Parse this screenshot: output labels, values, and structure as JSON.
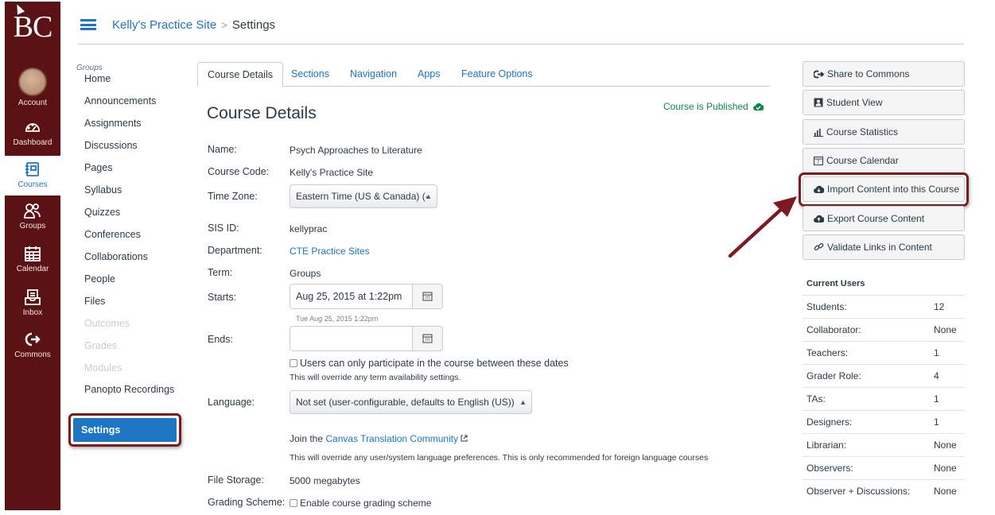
{
  "global_nav": {
    "logo": "BC",
    "items": [
      {
        "label": "Account",
        "icon": "avatar"
      },
      {
        "label": "Dashboard",
        "icon": "dashboard-icon"
      },
      {
        "label": "Courses",
        "icon": "courses-icon",
        "active": true
      },
      {
        "label": "Groups",
        "icon": "groups-icon"
      },
      {
        "label": "Calendar",
        "icon": "calendar-icon"
      },
      {
        "label": "Inbox",
        "icon": "inbox-icon"
      },
      {
        "label": "Commons",
        "icon": "commons-icon"
      }
    ]
  },
  "header": {
    "site": "Kelly's Practice Site",
    "separator": ">",
    "current": "Settings"
  },
  "course_nav": {
    "group_label": "Groups",
    "items": [
      "Home",
      "Announcements",
      "Assignments",
      "Discussions",
      "Pages",
      "Syllabus",
      "Quizzes",
      "Conferences",
      "Collaborations",
      "People",
      "Files"
    ],
    "disabled": [
      "Outcomes",
      "Grades",
      "Modules"
    ],
    "panopto": "Panopto Recordings",
    "settings": "Settings"
  },
  "tabs": [
    "Course Details",
    "Sections",
    "Navigation",
    "Apps",
    "Feature Options"
  ],
  "details": {
    "title": "Course Details",
    "published": "Course is Published",
    "name_label": "Name:",
    "name": "Psych Approaches to Literature",
    "code_label": "Course Code:",
    "code": "Kelly's Practice Site",
    "tz_label": "Time Zone:",
    "tz": "Eastern Time (US & Canada) (-",
    "sis_label": "SIS ID:",
    "sis": "kellyprac",
    "dept_label": "Department:",
    "dept": "CTE Practice Sites",
    "term_label": "Term:",
    "term": "Groups",
    "starts_label": "Starts:",
    "starts": "Aug 25, 2015 at  1:22pm",
    "starts_hint": "Tue Aug 25, 2015 1:22pm",
    "ends_label": "Ends:",
    "ends": "",
    "restrict_label": "Users can only participate in the course between these dates",
    "restrict_note": "This will override any term availability settings.",
    "lang_label": "Language:",
    "lang": "Not set (user-configurable, defaults to English (US))",
    "join_text": "Join the ",
    "join_link": "Canvas Translation Community",
    "lang_note": "This will override any user/system language preferences. This is only recommended for foreign language courses",
    "storage_label": "File Storage:",
    "storage": "5000 megabytes",
    "grading_label": "Grading Scheme:",
    "grading": "Enable course grading scheme"
  },
  "sidebar": {
    "buttons": [
      {
        "label": "Share to Commons",
        "icon": "share-icon"
      },
      {
        "label": "Student View",
        "icon": "student-view-icon"
      },
      {
        "label": "Course Statistics",
        "icon": "statistics-icon"
      },
      {
        "label": "Course Calendar",
        "icon": "calendar-icon"
      },
      {
        "label": "Import Content into this Course",
        "icon": "cloud-download-icon"
      },
      {
        "label": "Export Course Content",
        "icon": "cloud-upload-icon"
      },
      {
        "label": "Validate Links in Content",
        "icon": "link-icon"
      }
    ],
    "users_title": "Current Users",
    "users": [
      {
        "role": "Students:",
        "count": "12"
      },
      {
        "role": "Collaborator:",
        "count": "None"
      },
      {
        "role": "Teachers:",
        "count": "1"
      },
      {
        "role": "Grader Role:",
        "count": "4"
      },
      {
        "role": "TAs:",
        "count": "1"
      },
      {
        "role": "Designers:",
        "count": "1"
      },
      {
        "role": "Librarian:",
        "count": "None"
      },
      {
        "role": "Observers:",
        "count": "None"
      },
      {
        "role": "Observer + Discussions:",
        "count": "None"
      }
    ]
  },
  "colors": {
    "brand": "#5b1214",
    "link": "#1d75c4",
    "highlight": "#7d1a1f",
    "published": "#0b874b"
  }
}
